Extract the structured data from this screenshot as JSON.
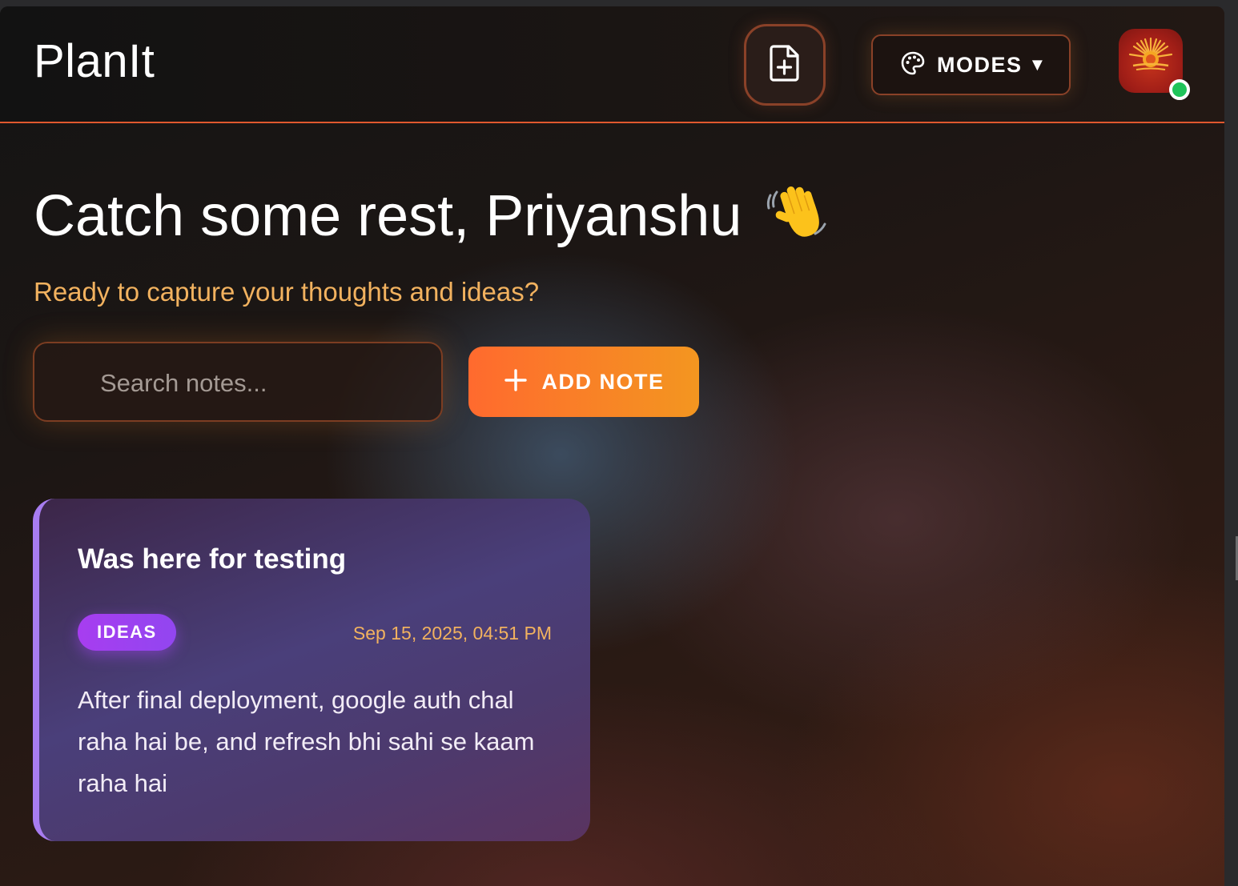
{
  "header": {
    "brand": "PlanIt",
    "new_note_icon": "file-plus-icon",
    "modes": {
      "icon": "palette-icon",
      "label": "MODES",
      "caret": "▼"
    },
    "avatar": {
      "icon": "sun-emblem-icon",
      "status": "online"
    }
  },
  "main": {
    "greeting": "Catch some rest, Priyanshu",
    "greeting_emoji": "👋",
    "subtitle": "Ready to capture your thoughts and ideas?",
    "search": {
      "placeholder": "Search notes...",
      "value": ""
    },
    "add_note": {
      "icon": "plus-icon",
      "label": "ADD NOTE"
    }
  },
  "notes": [
    {
      "title": "Was here for testing",
      "tag": "IDEAS",
      "date": "Sep 15, 2025, 04:51 PM",
      "body": "After final deployment, google auth chal raha hai be, and refresh bhi sahi se kaam raha hai"
    }
  ],
  "colors": {
    "accent": "#ff6a2e",
    "accent_end": "#f39620",
    "subtitle": "#f2b25f",
    "tag": "#a73df0",
    "card_border": "#a77cf0",
    "status_online": "#1fc45a"
  }
}
